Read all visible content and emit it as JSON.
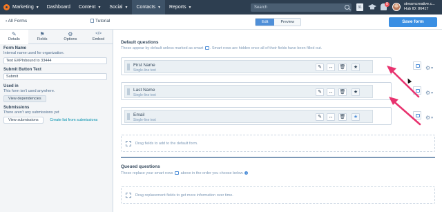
{
  "topnav": {
    "brand": "Marketing",
    "items": [
      {
        "label": "Dashboard",
        "caret": false,
        "active": false
      },
      {
        "label": "Content",
        "caret": true,
        "active": false
      },
      {
        "label": "Social",
        "caret": true,
        "active": false
      },
      {
        "label": "Contacts",
        "caret": true,
        "active": true
      },
      {
        "label": "Reports",
        "caret": true,
        "active": false
      }
    ],
    "search_placeholder": "Search",
    "calendar_day": "31",
    "notification_count": "8",
    "account_name": "streamcreative.c...",
    "hub_id": "Hub ID: 86417"
  },
  "subheader": {
    "back_label": "All Forms",
    "tutorial_label": "Tutorial",
    "view_toggle": [
      {
        "label": "Edit",
        "active": true
      },
      {
        "label": "Preview",
        "active": false
      }
    ],
    "save_label": "Save form"
  },
  "left_panel": {
    "tabs": [
      {
        "label": "Details",
        "icon": "pencil-icon",
        "active": true
      },
      {
        "label": "Fields",
        "icon": "flag-icon",
        "active": false
      },
      {
        "label": "Options",
        "icon": "gear-icon",
        "active": false
      },
      {
        "label": "Embed",
        "icon": "code-icon",
        "active": false
      }
    ],
    "form_name_heading": "Form Name",
    "form_name_help": "Internal name used for organization.",
    "form_name_value": "Text EXPInbound to 33444",
    "submit_heading": "Submit Button Text",
    "submit_value": "Submit",
    "used_in_heading": "Used in",
    "used_in_help": "This form isn't used anywhere.",
    "view_dependencies_label": "View dependencies",
    "submissions_heading": "Submissions",
    "submissions_help": "There aren't any submissions yet",
    "view_submissions_label": "View submissions",
    "create_list_label": "Create list from submissions"
  },
  "main": {
    "default_title": "Default questions",
    "default_help_before": "These appear by default unless marked as smart",
    "default_help_after": ". Smart rows are hidden once all of their fields have been filled out.",
    "fields": [
      {
        "name": "First Name",
        "type": "Single-line text",
        "starred": false
      },
      {
        "name": "Last Name",
        "type": "Single-line text",
        "starred": false
      },
      {
        "name": "Email",
        "type": "Single-line text",
        "starred": true
      }
    ],
    "default_drop_text": "Drag fields to add to the default form.",
    "queued_title": "Queued questions",
    "queued_help_before": "These replace your smart rows",
    "queued_help_after": "above in the order you choose below.",
    "queued_drop_text": "Drag replacement fields to get more information over time."
  },
  "colors": {
    "nav_bg": "#2d3e50",
    "primary_blue": "#3a8fe3",
    "annotation_pink": "#e8336f",
    "brand_orange": "#f57722"
  }
}
